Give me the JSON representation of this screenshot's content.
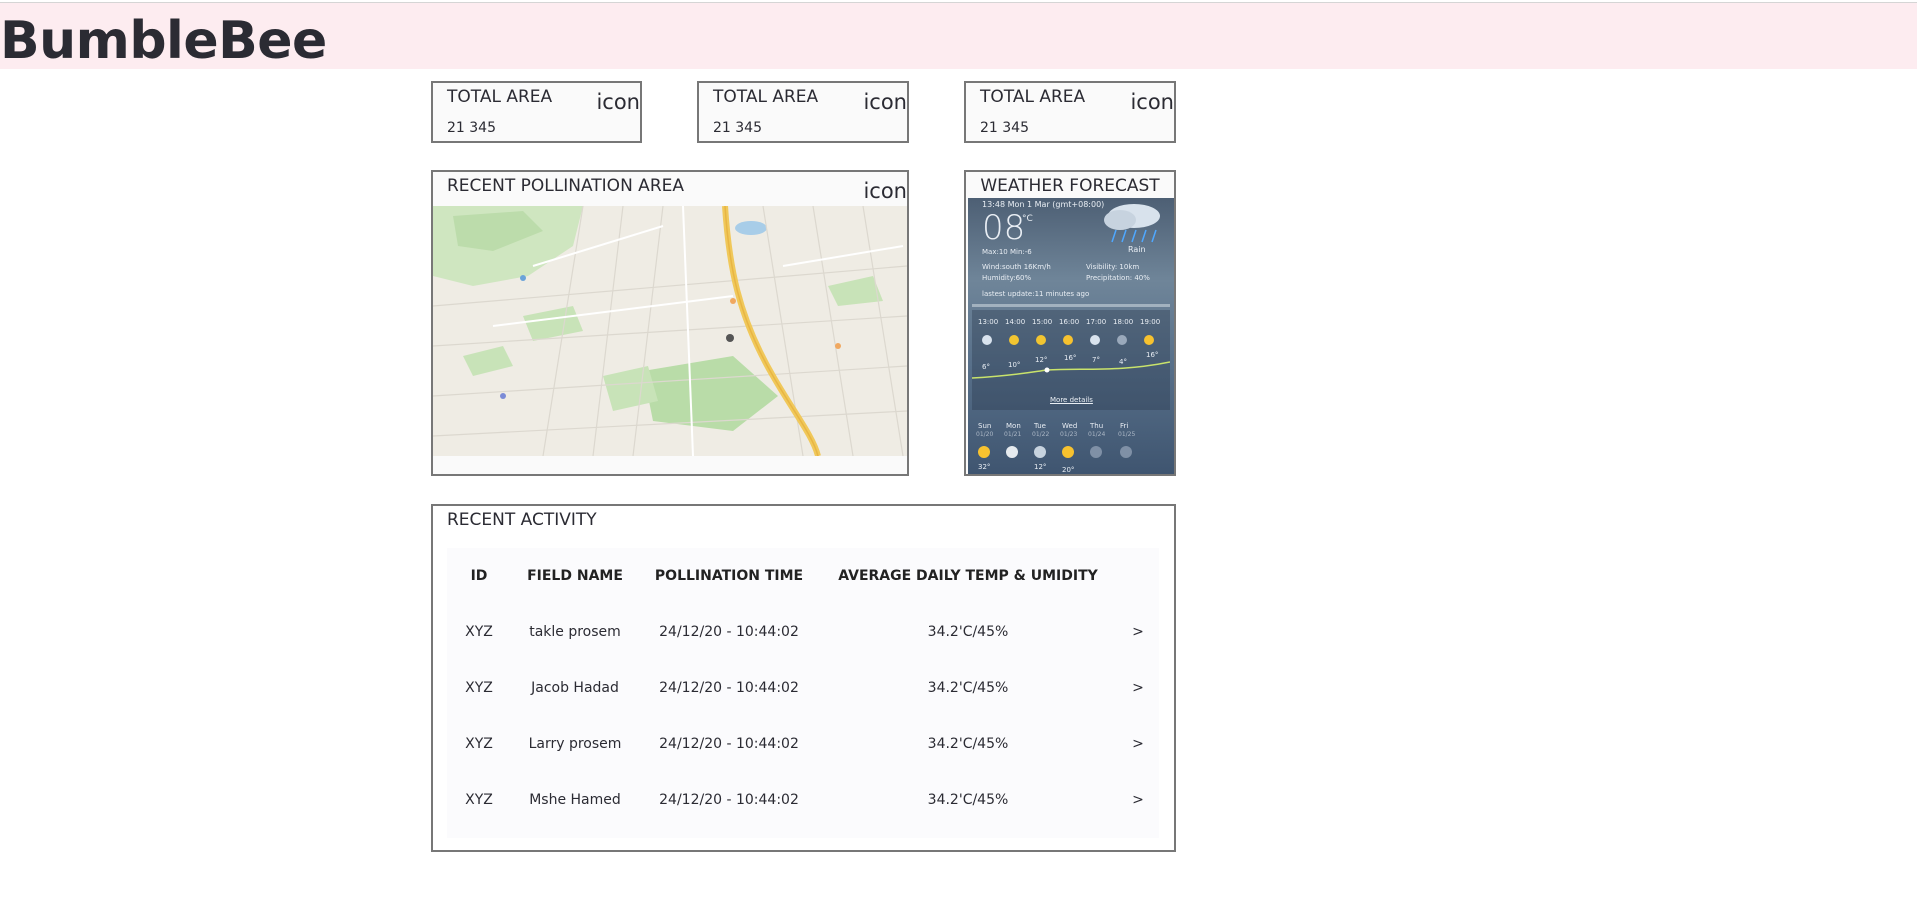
{
  "app": {
    "brand": "BumbleBee"
  },
  "stat_cards": [
    {
      "title": "TOTAL AREA",
      "icon_label": "icon",
      "value": "21 345"
    },
    {
      "title": "TOTAL AREA",
      "icon_label": "icon",
      "value": "21 345"
    },
    {
      "title": "TOTAL AREA",
      "icon_label": "icon",
      "value": "21 345"
    }
  ],
  "pollination": {
    "title": "RECENT POLLINATION AREA",
    "icon_label": "icon"
  },
  "weather": {
    "title": "WEATHER FORECAST",
    "widget": {
      "datetime": "13:48 Mon 1 Mar (gmt+08:00)",
      "temp": "08",
      "unit": "°C",
      "condition": "Rain",
      "maxmin": "Max:10  Min:-6",
      "wind": "Wind:south  16Km/h",
      "humidity": "Humidity:60%",
      "visibility": "Visibility: 10km",
      "precipitation": "Precipitation: 40%",
      "updated": "lastest update:11 minutes ago",
      "hours": [
        "13:00",
        "14:00",
        "15:00",
        "16:00",
        "17:00",
        "18:00",
        "19:00"
      ],
      "hour_temps": [
        "6°",
        "10°",
        "12°",
        "16°",
        "7°",
        "4°",
        "16°"
      ],
      "more": "More details",
      "days": [
        {
          "name": "Sun",
          "date": "01/20"
        },
        {
          "name": "Mon",
          "date": "01/21"
        },
        {
          "name": "Tue",
          "date": "01/22"
        },
        {
          "name": "Wed",
          "date": "01/23"
        },
        {
          "name": "Thu",
          "date": "01/24"
        },
        {
          "name": "Fri",
          "date": "01/25"
        }
      ],
      "day_temps": [
        "32°",
        "",
        "12°",
        "20°",
        "",
        ""
      ]
    }
  },
  "activity": {
    "title": "RECENT ACTIVITY",
    "columns": [
      "ID",
      "FIELD NAME",
      "POLLINATION TIME",
      "AVERAGE DAILY TEMP & UMIDITY"
    ],
    "rows": [
      {
        "id": "XYZ",
        "field": "takle prosem",
        "time": "24/12/20 - 10:44:02",
        "avg": "34.2'C/45%",
        "action": ">"
      },
      {
        "id": "XYZ",
        "field": "Jacob Hadad",
        "time": "24/12/20 - 10:44:02",
        "avg": "34.2'C/45%",
        "action": ">"
      },
      {
        "id": "XYZ",
        "field": "Larry prosem",
        "time": "24/12/20 - 10:44:02",
        "avg": "34.2'C/45%",
        "action": ">"
      },
      {
        "id": "XYZ",
        "field": "Mshe Hamed",
        "time": "24/12/20 - 10:44:02",
        "avg": "34.2'C/45%",
        "action": ">"
      }
    ]
  }
}
